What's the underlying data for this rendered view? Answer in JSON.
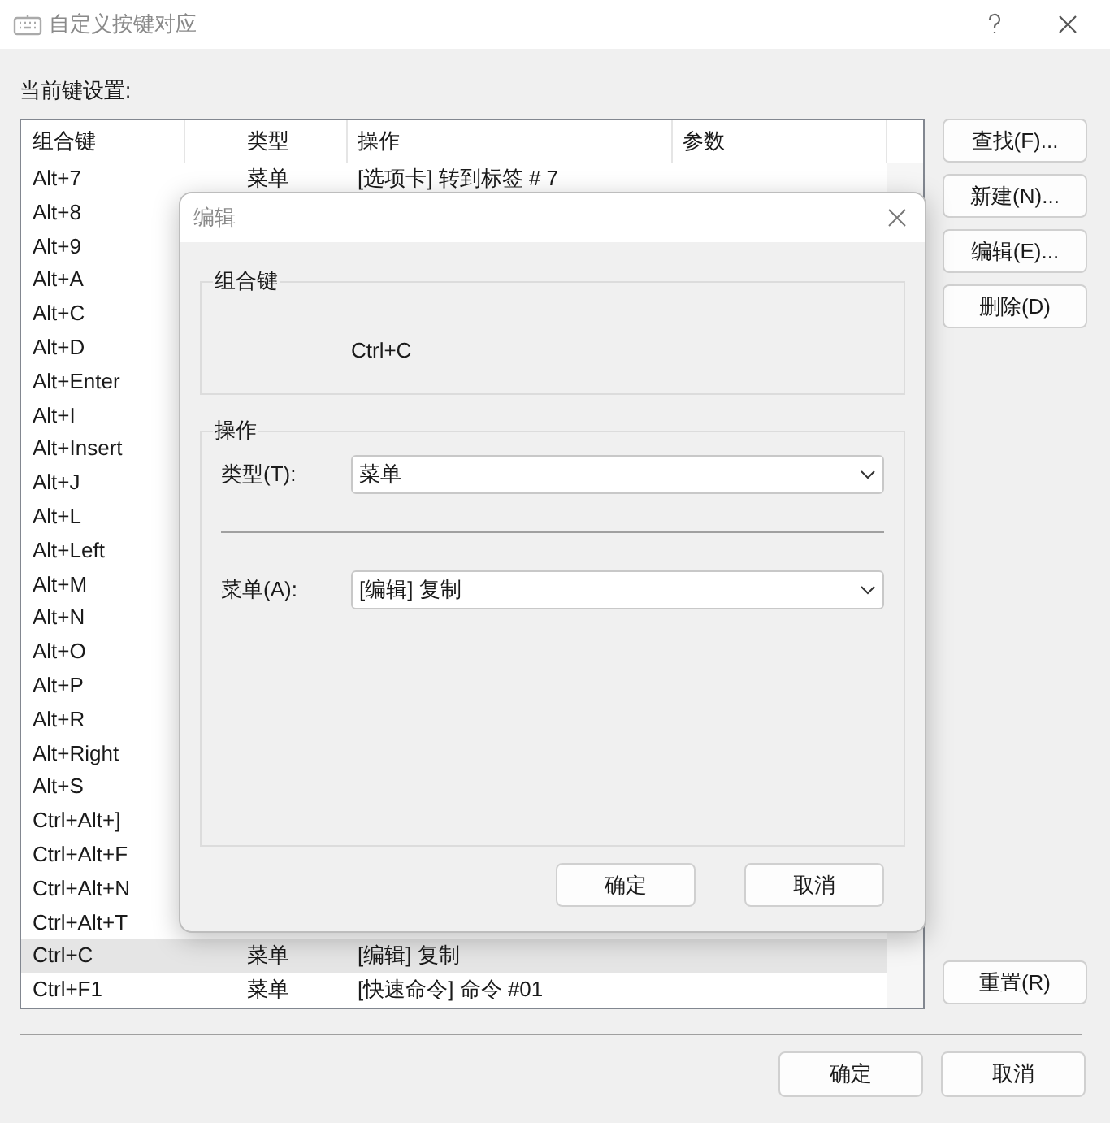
{
  "window": {
    "title": "自定义按键对应"
  },
  "section_label": "当前键设置:",
  "table": {
    "columns": [
      "组合键",
      "类型",
      "操作",
      "参数"
    ],
    "rows": [
      {
        "key": "Alt+7",
        "type": "菜单",
        "action": "[选项卡] 转到标签 # 7",
        "selected": false
      },
      {
        "key": "Alt+8",
        "selected": false
      },
      {
        "key": "Alt+9",
        "selected": false
      },
      {
        "key": "Alt+A",
        "selected": false
      },
      {
        "key": "Alt+C",
        "selected": false
      },
      {
        "key": "Alt+D",
        "selected": false
      },
      {
        "key": "Alt+Enter",
        "selected": false
      },
      {
        "key": "Alt+I",
        "selected": false
      },
      {
        "key": "Alt+Insert",
        "selected": false
      },
      {
        "key": "Alt+J",
        "selected": false
      },
      {
        "key": "Alt+L",
        "selected": false
      },
      {
        "key": "Alt+Left",
        "selected": false
      },
      {
        "key": "Alt+M",
        "selected": false
      },
      {
        "key": "Alt+N",
        "selected": false
      },
      {
        "key": "Alt+O",
        "selected": false
      },
      {
        "key": "Alt+P",
        "selected": false
      },
      {
        "key": "Alt+R",
        "selected": false
      },
      {
        "key": "Alt+Right",
        "selected": false
      },
      {
        "key": "Alt+S",
        "selected": false
      },
      {
        "key": "Ctrl+Alt+]",
        "selected": false
      },
      {
        "key": "Ctrl+Alt+F",
        "selected": false
      },
      {
        "key": "Ctrl+Alt+N",
        "selected": false
      },
      {
        "key": "Ctrl+Alt+T",
        "selected": false
      },
      {
        "key": "Ctrl+C",
        "type": "菜单",
        "action": "[编辑] 复制",
        "selected": true
      },
      {
        "key": "Ctrl+F1",
        "type": "菜单",
        "action": "[快速命令] 命令 #01",
        "selected": false
      }
    ]
  },
  "side_buttons": [
    "查找(F)...",
    "新建(N)...",
    "编辑(E)...",
    "删除(D)"
  ],
  "reset_button": "重置(R)",
  "footer_buttons": [
    "确定",
    "取消"
  ],
  "dialog": {
    "title": "编辑",
    "key_group": {
      "label": "组合键",
      "value": "Ctrl+C"
    },
    "action_group": {
      "label": "操作",
      "fields": [
        {
          "label": "类型(T):",
          "value": "菜单"
        },
        {
          "label": "菜单(A):",
          "value": "[编辑] 复制"
        }
      ]
    },
    "buttons": [
      "确定",
      "取消"
    ]
  }
}
